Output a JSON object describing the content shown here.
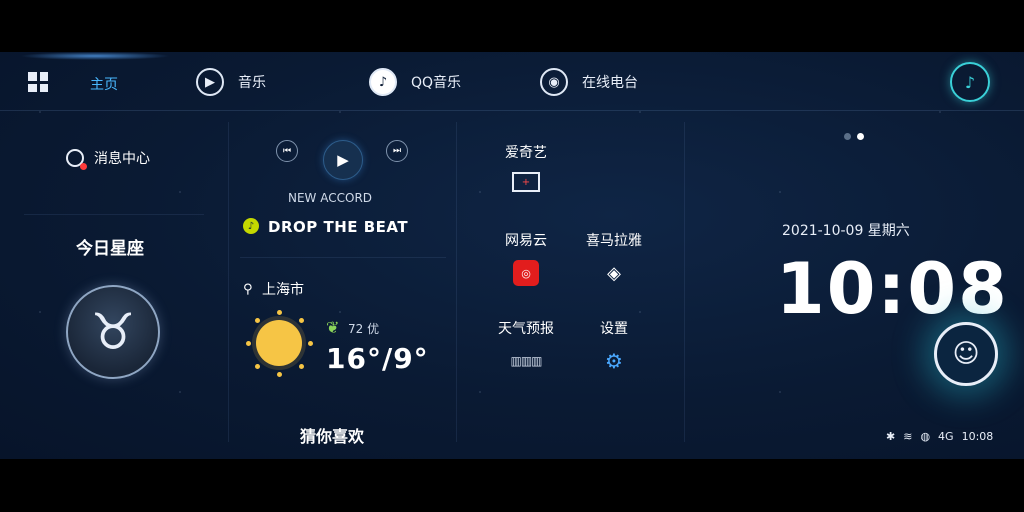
{
  "nav": {
    "home_label": "主页",
    "items": [
      {
        "label": "音乐",
        "icon": "play-circle-icon"
      },
      {
        "label": "QQ音乐",
        "icon": "qq-music-icon"
      },
      {
        "label": "在线电台",
        "icon": "radio-icon"
      }
    ]
  },
  "left": {
    "message_center": "消息中心",
    "astro_title": "今日星座",
    "astro_symbol": "♉"
  },
  "music": {
    "artist": "NEW ACCORD",
    "song": "DROP THE BEAT"
  },
  "weather": {
    "title": "上海市",
    "aqi": "72 优",
    "temp": "16°/9°",
    "colors": {
      "sun": "#f6c545",
      "leaf": "#8bd45a"
    }
  },
  "recommend_label": "猜你喜欢",
  "apps": [
    {
      "label": "爱奇艺",
      "icon": "tv-icon"
    },
    {
      "label": "网易云",
      "icon": "netease-icon"
    },
    {
      "label": "喜马拉雅",
      "icon": "ximalaya-icon"
    },
    {
      "label": "天气预报",
      "icon": "forecast-icon"
    },
    {
      "label": "设置",
      "icon": "settings-icon"
    }
  ],
  "clock": {
    "date": "2021-10-09 星期六",
    "time": "10:08"
  },
  "status": {
    "time": "10:08",
    "signal": "4G"
  },
  "colors": {
    "accent": "#49b8ff",
    "voice": "#3ad0d8",
    "background": "#0a1a33"
  }
}
